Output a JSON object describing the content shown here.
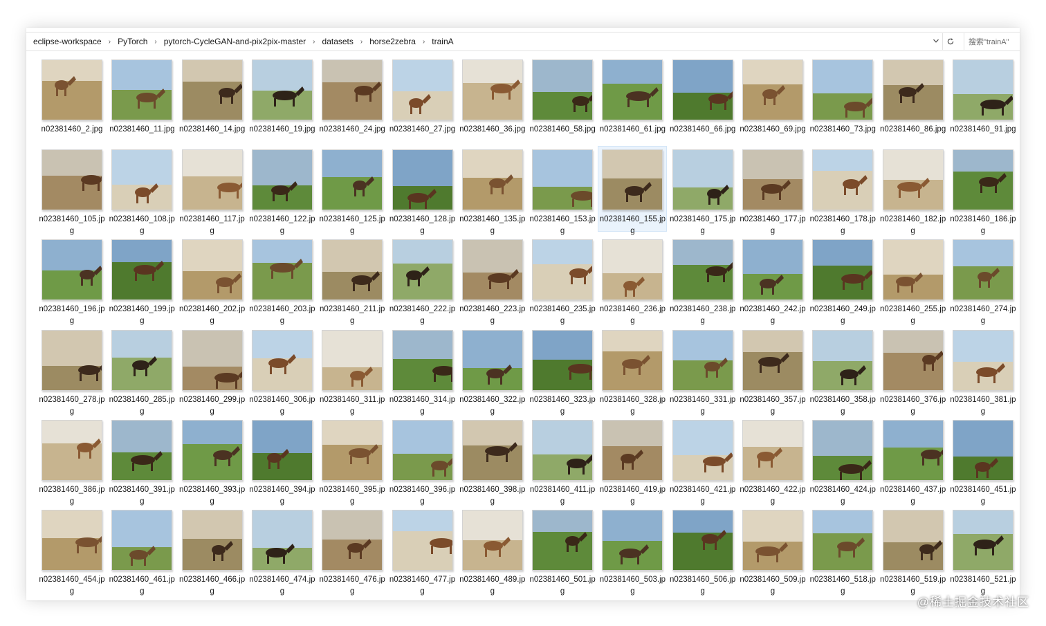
{
  "breadcrumb": [
    "eclipse-workspace",
    "PyTorch",
    "pytorch-CycleGAN-and-pix2pix-master",
    "datasets",
    "horse2zebra",
    "trainA"
  ],
  "search_placeholder": "搜索\"trainA\"",
  "icons": {
    "separator": "chevron-right-icon",
    "dropdown": "chevron-down-icon",
    "refresh": "refresh-icon"
  },
  "selected_file": "n02381460_155.jpg",
  "files": [
    "n02381460_2.jpg",
    "n02381460_11.jpg",
    "n02381460_14.jpg",
    "n02381460_19.jpg",
    "n02381460_24.jpg",
    "n02381460_27.jpg",
    "n02381460_36.jpg",
    "n02381460_58.jpg",
    "n02381460_61.jpg",
    "n02381460_66.jpg",
    "n02381460_69.jpg",
    "n02381460_73.jpg",
    "n02381460_86.jpg",
    "n02381460_91.jpg",
    "n02381460_105.jpg",
    "n02381460_108.jpg",
    "n02381460_117.jpg",
    "n02381460_122.jpg",
    "n02381460_125.jpg",
    "n02381460_128.jpg",
    "n02381460_135.jpg",
    "n02381460_153.jpg",
    "n02381460_155.jpg",
    "n02381460_175.jpg",
    "n02381460_177.jpg",
    "n02381460_178.jpg",
    "n02381460_182.jpg",
    "n02381460_186.jpg",
    "n02381460_196.jpg",
    "n02381460_199.jpg",
    "n02381460_202.jpg",
    "n02381460_203.jpg",
    "n02381460_211.jpg",
    "n02381460_222.jpg",
    "n02381460_223.jpg",
    "n02381460_235.jpg",
    "n02381460_236.jpg",
    "n02381460_238.jpg",
    "n02381460_242.jpg",
    "n02381460_249.jpg",
    "n02381460_255.jpg",
    "n02381460_274.jpg",
    "n02381460_278.jpg",
    "n02381460_285.jpg",
    "n02381460_299.jpg",
    "n02381460_306.jpg",
    "n02381460_311.jpg",
    "n02381460_314.jpg",
    "n02381460_322.jpg",
    "n02381460_323.jpg",
    "n02381460_328.jpg",
    "n02381460_331.jpg",
    "n02381460_357.jpg",
    "n02381460_358.jpg",
    "n02381460_376.jpg",
    "n02381460_381.jpg",
    "n02381460_386.jpg",
    "n02381460_391.jpg",
    "n02381460_393.jpg",
    "n02381460_394.jpg",
    "n02381460_395.jpg",
    "n02381460_396.jpg",
    "n02381460_398.jpg",
    "n02381460_411.jpg",
    "n02381460_419.jpg",
    "n02381460_421.jpg",
    "n02381460_422.jpg",
    "n02381460_424.jpg",
    "n02381460_437.jpg",
    "n02381460_451.jpg",
    "n02381460_454.jpg",
    "n02381460_461.jpg",
    "n02381460_466.jpg",
    "n02381460_474.jpg",
    "n02381460_476.jpg",
    "n02381460_477.jpg",
    "n02381460_489.jpg",
    "n02381460_501.jpg",
    "n02381460_503.jpg",
    "n02381460_506.jpg",
    "n02381460_509.jpg",
    "n02381460_518.jpg",
    "n02381460_519.jpg",
    "n02381460_521.jpg"
  ],
  "watermark": "@稀土掘金技术社区"
}
